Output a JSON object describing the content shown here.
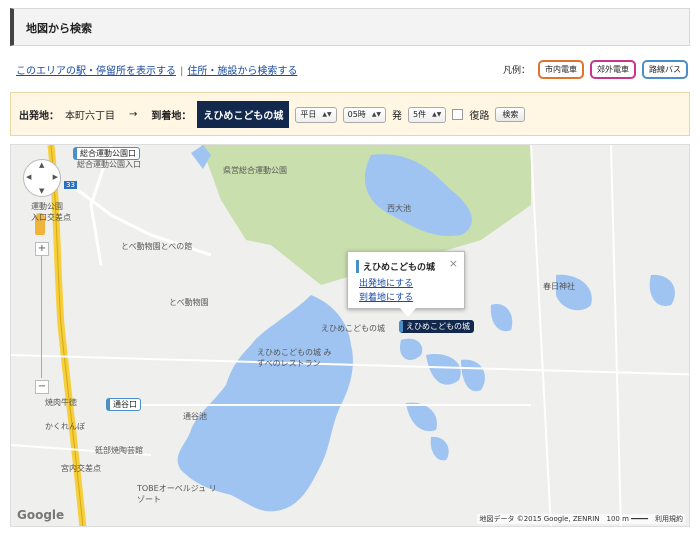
{
  "header": {
    "title": "地図から検索"
  },
  "links": {
    "stations": "このエリアの駅・停留所を表示する",
    "separator": "|",
    "address": "住所・施設から検索する"
  },
  "legend": {
    "label": "凡例：",
    "items": [
      {
        "label": "市内電車",
        "color": "#e0742f"
      },
      {
        "label": "郊外電車",
        "color": "#c9358c"
      },
      {
        "label": "路線バス",
        "color": "#4a8fc7"
      }
    ]
  },
  "route": {
    "from_label": "出発地：",
    "from_value": "本町六丁目",
    "arrow": "→",
    "to_label": "到着地：",
    "to_value": "えひめこどもの城",
    "day": "平日",
    "hour": "05時",
    "depart_suffix": "発",
    "count": "5件",
    "roundtrip": "復路",
    "search": "検索"
  },
  "map": {
    "popup": {
      "title": "えひめこどもの城",
      "set_origin": "出発地にする",
      "set_destination": "到着地にする",
      "close": "×"
    },
    "stops": [
      {
        "label": "総合運動公園口"
      },
      {
        "label": "えひめこどもの城"
      },
      {
        "label": "通谷口"
      }
    ],
    "labels": [
      "総合運動公園入口",
      "県営総合運動公園",
      "西大池",
      "とべ動物園とべの館",
      "とべ動物園",
      "えひめこどもの城",
      "えひめこどもの城 みずべのレストラン",
      "春日神社",
      "通谷池",
      "焼肉牛徳",
      "かくれんぼ",
      "砥部焼陶芸館",
      "宮内交差点",
      "TOBEオーベルジュ リゾート",
      "運動公園 入口交差点"
    ],
    "route_number": "33",
    "zoom_in": "+",
    "zoom_out": "−",
    "google": "Google",
    "attribution": "地図データ ©2015 Google, ZENRIN　100 m ━━━━　利用規約"
  }
}
